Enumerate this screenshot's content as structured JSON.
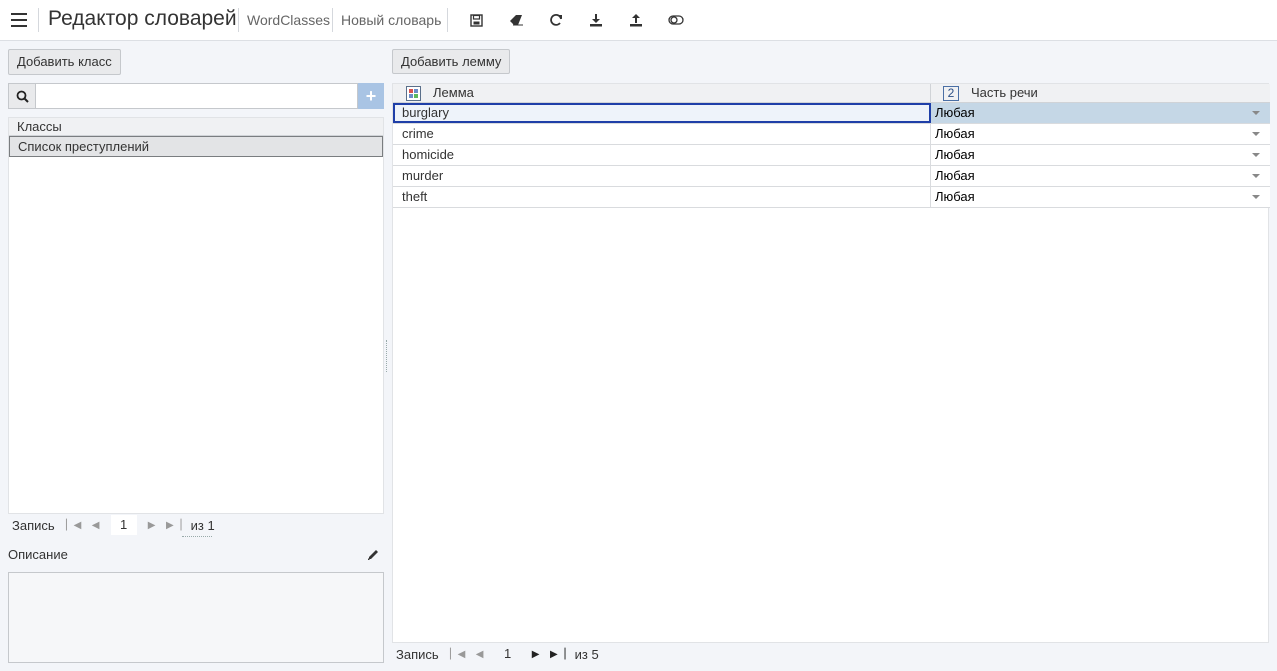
{
  "header": {
    "title": "Редактор словарей",
    "breadcrumb_1": "WordClasses",
    "breadcrumb_2": "Новый словарь",
    "tools": [
      "save-icon",
      "eraser-icon",
      "refresh-icon",
      "download-icon",
      "upload-icon",
      "toggle-icon"
    ]
  },
  "left": {
    "add_class_label": "Добавить класс",
    "search": {
      "value": "",
      "placeholder": ""
    },
    "grid_header": "Классы",
    "classes": [
      "Список преступлений"
    ],
    "pager": {
      "label": "Запись",
      "page": "1",
      "of": "из 1"
    },
    "description_label": "Описание",
    "description": ""
  },
  "right": {
    "add_lemma_label": "Добавить лемму",
    "col_lemma": "Лемма",
    "col_pos": "Часть речи",
    "col_pos_badge": "2",
    "rows": [
      {
        "lemma": "burglary",
        "pos": "Любая"
      },
      {
        "lemma": "crime",
        "pos": "Любая"
      },
      {
        "lemma": "homicide",
        "pos": "Любая"
      },
      {
        "lemma": "murder",
        "pos": "Любая"
      },
      {
        "lemma": "theft",
        "pos": "Любая"
      }
    ],
    "selected_row": 0,
    "pager": {
      "label": "Запись",
      "page": "1",
      "of": "из 5"
    }
  },
  "colors": {
    "accent": "#1f3fa8",
    "selected_cell": "#c5d7e6",
    "add_button": "#a9c4e4"
  }
}
